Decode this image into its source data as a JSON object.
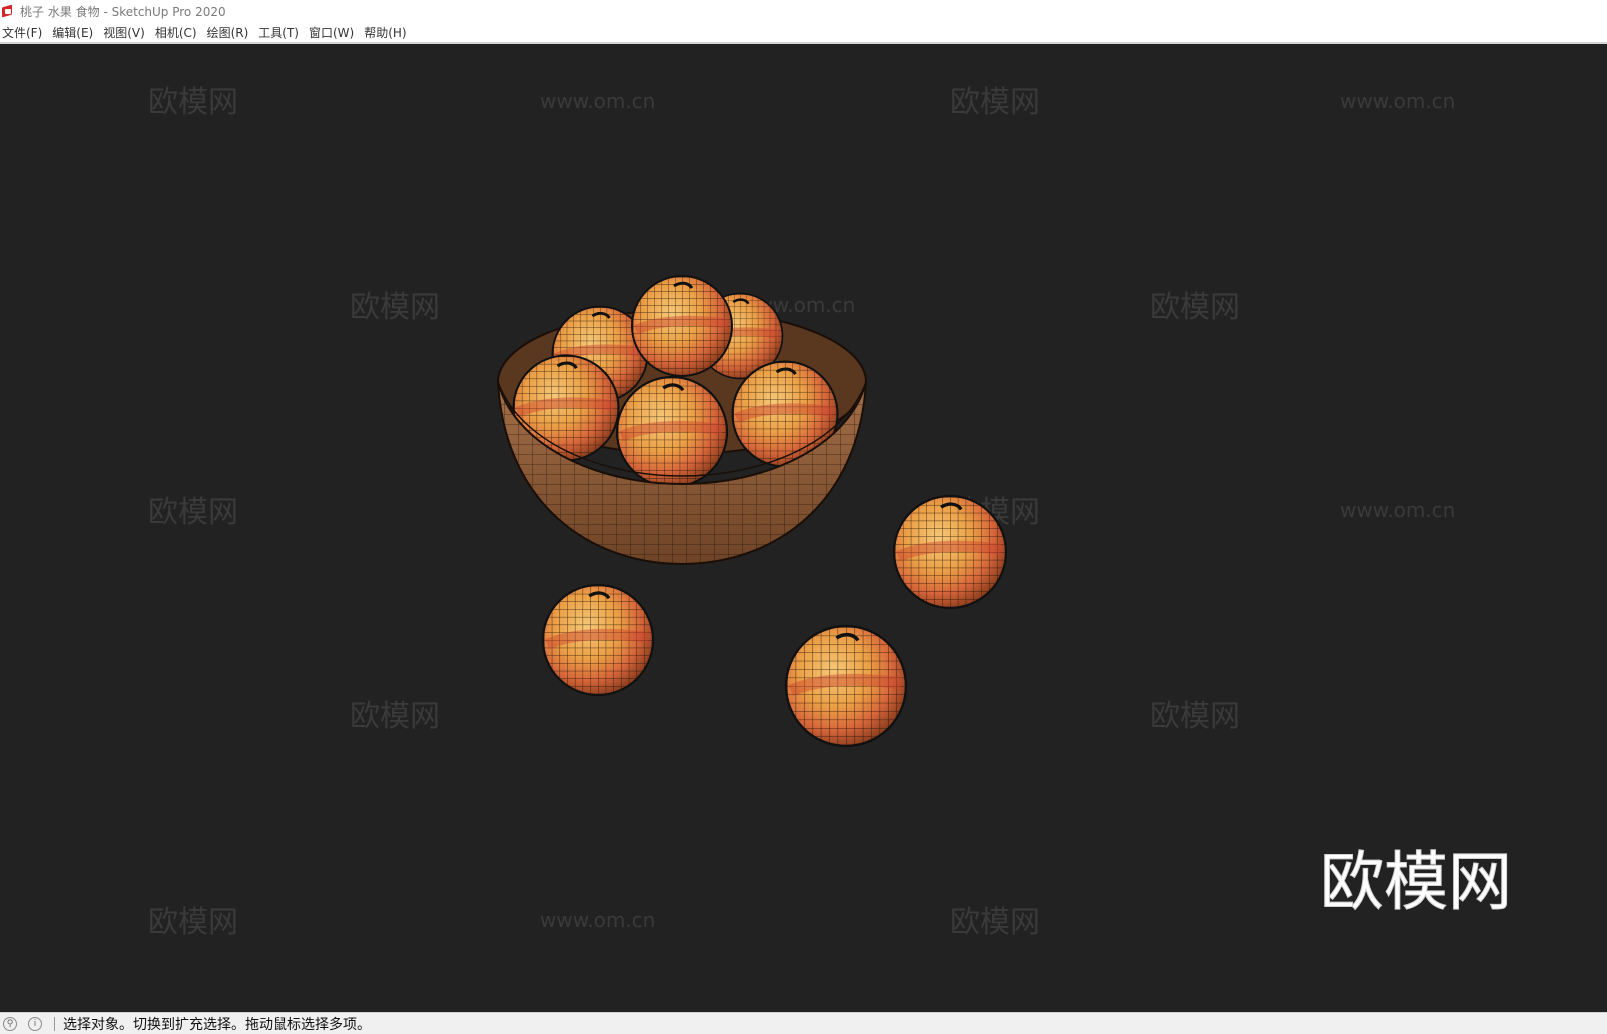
{
  "window": {
    "title": "桃子 水果 食物 - SketchUp Pro 2020",
    "icon": "sketchup-logo-icon"
  },
  "menu": {
    "items": [
      {
        "label": "文件(F)"
      },
      {
        "label": "编辑(E)"
      },
      {
        "label": "视图(V)"
      },
      {
        "label": "相机(C)"
      },
      {
        "label": "绘图(R)"
      },
      {
        "label": "工具(T)"
      },
      {
        "label": "窗口(W)"
      },
      {
        "label": "帮助(H)"
      }
    ]
  },
  "viewport": {
    "background": "#222222",
    "watermark_cn": "欧模网",
    "watermark_url": "www.om.cn",
    "brand_logo": "欧模网",
    "brand_url": "www.om.cn",
    "model_colors": {
      "peach": "#e8a044",
      "blush": "#d7563a",
      "bowl": "#8a5a36",
      "wire": "#1a0f08"
    }
  },
  "statusbar": {
    "geo_icon": "geolocation-icon",
    "info_icon": "info-icon",
    "message": "选择对象。切换到扩充选择。拖动鼠标选择多项。"
  }
}
